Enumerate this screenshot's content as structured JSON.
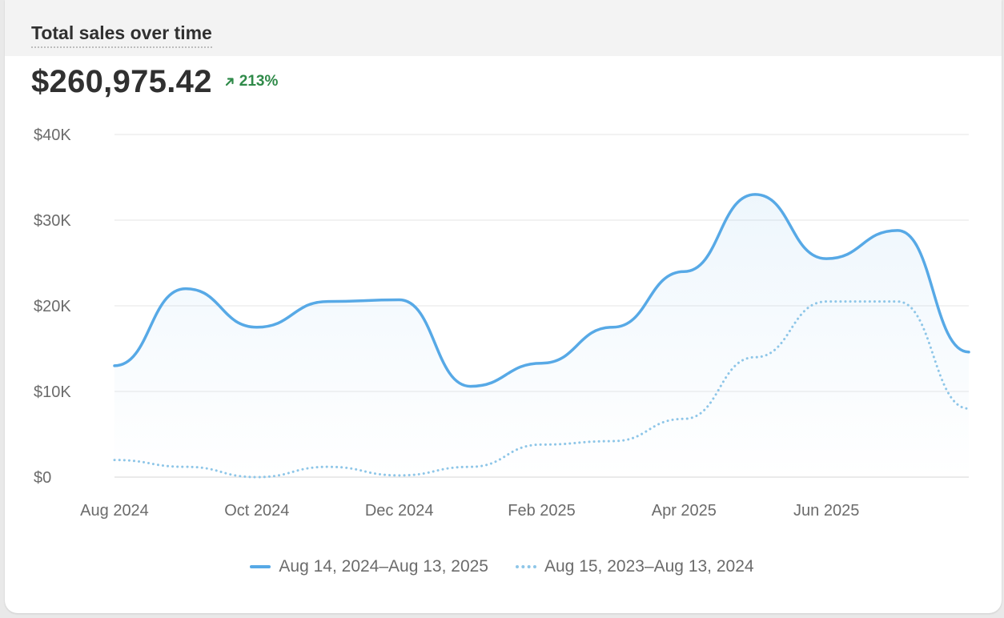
{
  "card": {
    "title": "Total sales over time",
    "total": "$260,975.42",
    "change": "213%",
    "change_icon": "arrow-up-right-icon"
  },
  "colors": {
    "current": "#57a9e6",
    "previous": "#8ec6e8",
    "positive": "#2f8a49"
  },
  "chart_data": {
    "type": "line",
    "x_tick_labels": [
      "Aug 2024",
      "Oct 2024",
      "Dec 2024",
      "Feb 2025",
      "Apr 2025",
      "Jun 2025"
    ],
    "y_tick_labels": [
      "$0",
      "$10K",
      "$20K",
      "$30K",
      "$40K"
    ],
    "ylim": [
      0,
      40000
    ],
    "grid": true,
    "legend_position": "bottom",
    "series": [
      {
        "name": "Aug 14, 2024–Aug 13, 2025",
        "style": "solid",
        "values": [
          13000,
          22000,
          17500,
          20500,
          20700,
          10600,
          13300,
          17500,
          24000,
          33000,
          25500,
          28800,
          14600
        ]
      },
      {
        "name": "Aug 15, 2023–Aug 13, 2024",
        "style": "dotted",
        "values": [
          2000,
          1200,
          0,
          1200,
          200,
          1200,
          3800,
          4200,
          6800,
          14000,
          20500,
          20500,
          8000
        ]
      }
    ]
  }
}
